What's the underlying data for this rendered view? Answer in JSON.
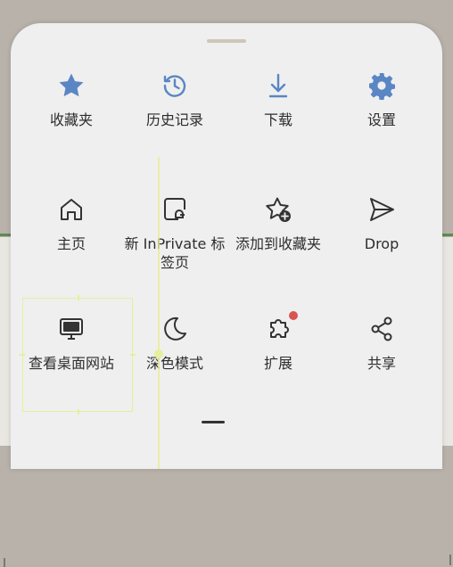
{
  "menu": {
    "rows": [
      [
        {
          "label": "收藏夹",
          "icon": "star-icon"
        },
        {
          "label": "历史记录",
          "icon": "history-icon"
        },
        {
          "label": "下载",
          "icon": "download-icon"
        },
        {
          "label": "设置",
          "icon": "gear-icon"
        }
      ],
      [
        {
          "label": "主页",
          "icon": "home-icon"
        },
        {
          "label": "新 InPrivate 标签页",
          "icon": "inprivate-tab-icon"
        },
        {
          "label": "添加到收藏夹",
          "icon": "add-favorite-icon"
        },
        {
          "label": "Drop",
          "icon": "send-icon"
        }
      ],
      [
        {
          "label": "查看桌面网站",
          "icon": "desktop-site-icon"
        },
        {
          "label": "深色模式",
          "icon": "moon-icon"
        },
        {
          "label": "扩展",
          "icon": "extensions-icon"
        },
        {
          "label": "共享",
          "icon": "share-icon"
        }
      ]
    ]
  },
  "colors": {
    "accent_icon": "#5a86c4",
    "badge": "#d9534f",
    "sheet_bg": "#efefef"
  }
}
